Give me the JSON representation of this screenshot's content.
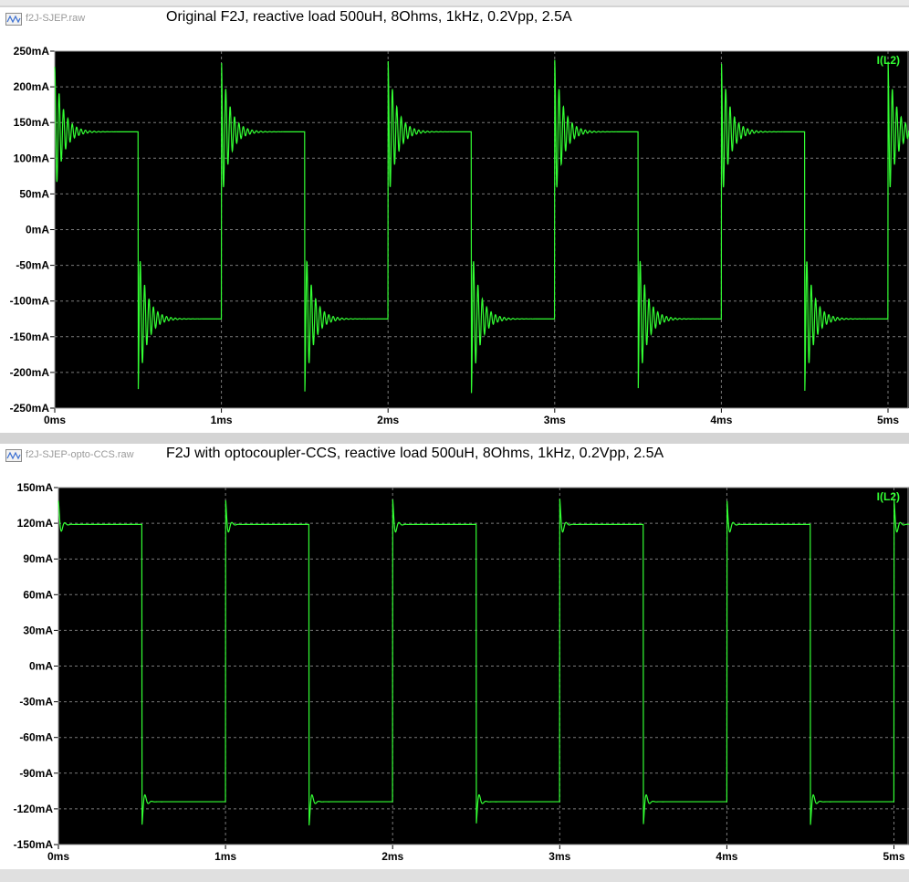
{
  "plots": [
    {
      "file_name": "f2J-SJEP.raw",
      "caption": "Original F2J, reactive load 500uH, 8Ohms, 1kHz, 0.2Vpp, 2.5A",
      "trace_label": "I(L2)",
      "y_ticks": [
        "250mA",
        "200mA",
        "150mA",
        "100mA",
        "50mA",
        "0mA",
        "-50mA",
        "-100mA",
        "-150mA",
        "-200mA",
        "-250mA"
      ],
      "x_ticks": [
        "0ms",
        "1ms",
        "2ms",
        "3ms",
        "4ms",
        "5ms"
      ]
    },
    {
      "file_name": "f2J-SJEP-opto-CCS.raw",
      "caption": "F2J with optocoupler-CCS, reactive load 500uH, 8Ohms, 1kHz, 0.2Vpp, 2.5A",
      "trace_label": "I(L2)",
      "y_ticks": [
        "150mA",
        "120mA",
        "90mA",
        "60mA",
        "30mA",
        "0mA",
        "-30mA",
        "-60mA",
        "-90mA",
        "-120mA",
        "-150mA"
      ],
      "x_ticks": [
        "0ms",
        "1ms",
        "2ms",
        "3ms",
        "4ms",
        "5ms"
      ]
    }
  ],
  "chart_data": [
    {
      "type": "line",
      "title": "Original F2J, reactive load 500uH, 8Ohms, 1kHz, 0.2Vpp, 2.5A",
      "xlabel": "",
      "ylabel": "",
      "x_unit": "ms",
      "y_unit": "mA",
      "xlim": [
        0,
        5.1
      ],
      "ylim": [
        -250,
        250
      ],
      "grid": true,
      "series": [
        {
          "name": "I(L2)",
          "color": "#33ff33",
          "waveform": "square",
          "period_ms": 1.0,
          "duty": 0.5,
          "high_level_mA": 137,
          "low_level_mA": -125,
          "rising_edges_ms": [
            0.0,
            1.0,
            2.0,
            3.0,
            4.0,
            5.0
          ],
          "falling_edges_ms": [
            0.5,
            1.5,
            2.5,
            3.5,
            4.5
          ],
          "overshoot_peak_mA": 238,
          "undershoot_peak_mA": -230,
          "ringing_freq_kHz": 38,
          "ringing_decay_ms": 0.05
        }
      ]
    },
    {
      "type": "line",
      "title": "F2J with optocoupler-CCS, reactive load 500uH, 8Ohms, 1kHz, 0.2Vpp, 2.5A",
      "xlabel": "",
      "ylabel": "",
      "x_unit": "ms",
      "y_unit": "mA",
      "xlim": [
        0,
        5.1
      ],
      "ylim": [
        -150,
        150
      ],
      "grid": true,
      "series": [
        {
          "name": "I(L2)",
          "color": "#33ff33",
          "waveform": "square",
          "period_ms": 1.0,
          "duty": 0.5,
          "high_level_mA": 119,
          "low_level_mA": -114,
          "rising_edges_ms": [
            0.0,
            1.0,
            2.0,
            3.0,
            4.0,
            5.0
          ],
          "falling_edges_ms": [
            0.5,
            1.5,
            2.5,
            3.5,
            4.5
          ],
          "overshoot_peak_mA": 141,
          "undershoot_peak_mA": -134,
          "ringing_freq_kHz": 25,
          "ringing_decay_ms": 0.015
        }
      ]
    }
  ]
}
